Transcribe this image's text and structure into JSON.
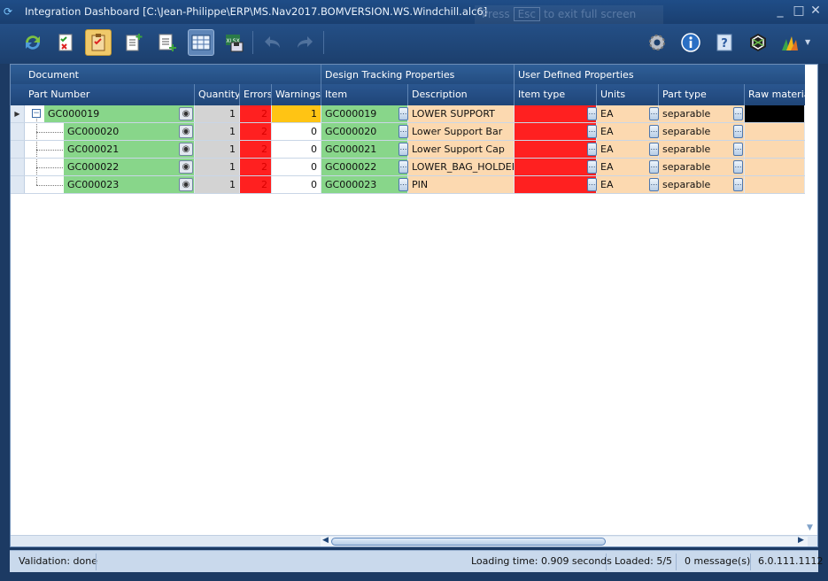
{
  "window": {
    "title": "Integration Dashboard [C:\\Jean-Philippe\\ERP\\MS.Nav2017.BOMVERSION.WS.Windchill.alc6]",
    "hint_prefix": "Press",
    "hint_key": "Esc",
    "hint_suffix": "to exit full screen",
    "minimize": "_",
    "maximize": "□",
    "close": "✕"
  },
  "toolbar": {
    "buttons": [
      {
        "icon": "refresh-icon"
      },
      {
        "icon": "checklist-icon"
      },
      {
        "icon": "clipboard-icon",
        "state": "active"
      },
      {
        "icon": "new-document-icon"
      },
      {
        "icon": "add-list-icon"
      },
      {
        "icon": "grid-view-icon",
        "state": "selected"
      },
      {
        "icon": "export-xlsx-icon",
        "label": "XLSX"
      },
      {
        "icon": "undo-icon",
        "state": "disabled"
      },
      {
        "icon": "redo-icon",
        "state": "disabled"
      },
      {
        "icon": "settings-gear-icon"
      },
      {
        "icon": "info-icon"
      },
      {
        "icon": "help-icon"
      },
      {
        "icon": "connector-logo-icon"
      },
      {
        "icon": "dynamics-logo-icon"
      }
    ]
  },
  "grid": {
    "group_headers": {
      "document": "Document",
      "design_tracking": "Design Tracking Properties",
      "user_defined": "User Defined Properties"
    },
    "columns": {
      "part_number": "Part Number",
      "quantity": "Quantity",
      "errors": "Errors",
      "warnings": "Warnings",
      "item": "Item",
      "description": "Description",
      "item_type": "Item type",
      "units": "Units",
      "part_type": "Part type",
      "raw_material": "Raw material"
    },
    "rows": [
      {
        "part_number": "GC000019",
        "quantity": "1",
        "errors": "2",
        "warnings": "1",
        "item": "GC000019",
        "description": "LOWER SUPPORT",
        "units": "EA",
        "part_type": "separable",
        "is_parent": true
      },
      {
        "part_number": "GC000020",
        "quantity": "1",
        "errors": "2",
        "warnings": "0",
        "item": "GC000020",
        "description": "Lower Support Bar",
        "units": "EA",
        "part_type": "separable"
      },
      {
        "part_number": "GC000021",
        "quantity": "1",
        "errors": "2",
        "warnings": "0",
        "item": "GC000021",
        "description": "Lower Support Cap",
        "units": "EA",
        "part_type": "separable"
      },
      {
        "part_number": "GC000022",
        "quantity": "1",
        "errors": "2",
        "warnings": "0",
        "item": "GC000022",
        "description": "LOWER_BAG_HOLDER",
        "units": "EA",
        "part_type": "separable"
      },
      {
        "part_number": "GC000023",
        "quantity": "1",
        "errors": "2",
        "warnings": "0",
        "item": "GC000023",
        "description": "PIN",
        "units": "EA",
        "part_type": "separable"
      }
    ],
    "colors": {
      "ok": "#88d68a",
      "error": "#ff2020",
      "warning": "#ffc414",
      "readonly": "#d3d3d3",
      "user_defined": "#fcd9b0"
    }
  },
  "status": {
    "validation": "Validation: done",
    "loading_time": "Loading time: 0.909 seconds",
    "loaded": "Loaded: 5/5",
    "messages": "0 message(s)",
    "version": "6.0.111.1112"
  }
}
